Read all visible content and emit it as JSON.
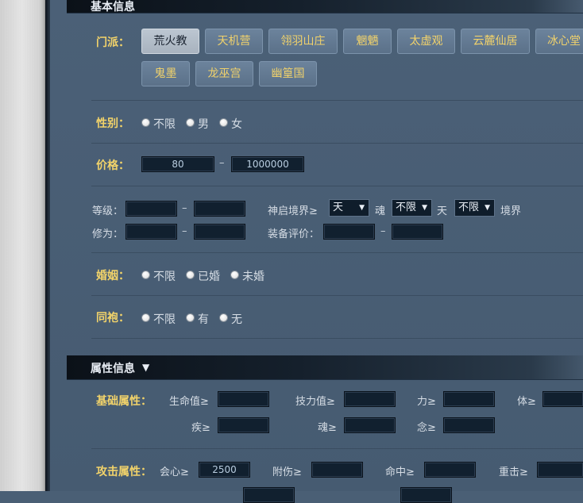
{
  "section_basic": {
    "title": "基本信息"
  },
  "sect": {
    "label": "门派：",
    "items": [
      "荒火教",
      "天机营",
      "翎羽山庄",
      "魍魉",
      "太虚观",
      "云麓仙居",
      "冰心堂",
      "鬼墨",
      "龙巫宫",
      "幽篁国"
    ]
  },
  "gender": {
    "label": "性别：",
    "options": [
      "不限",
      "男",
      "女"
    ]
  },
  "price": {
    "label": "价格：",
    "min": "80",
    "dash": "–",
    "max": "1000000"
  },
  "level": {
    "label": "等级：",
    "dash": "–"
  },
  "realm": {
    "label": "神启境界≥",
    "sel1": "天",
    "mid1": "魂",
    "sel2": "不限",
    "mid2": "天",
    "sel3": "不限",
    "suffix": "境界"
  },
  "cultivation": {
    "label": "修为：",
    "dash": "–"
  },
  "equip": {
    "label": "装备评价：",
    "dash": "–"
  },
  "marriage": {
    "label": "婚姻：",
    "options": [
      "不限",
      "已婚",
      "未婚"
    ]
  },
  "brother": {
    "label": "同袍：",
    "options": [
      "不限",
      "有",
      "无"
    ]
  },
  "section_attr": {
    "title": "属性信息",
    "caret": "▼"
  },
  "base_attr": {
    "label": "基础属性：",
    "hp": "生命值≥",
    "skill": "技力值≥",
    "str": "力≥",
    "con": "体≥",
    "agi": "疾≥",
    "soul": "魂≥",
    "mind": "念≥"
  },
  "atk_attr": {
    "label": "攻击属性：",
    "crit": "会心≥",
    "crit_val": "2500",
    "extra": "附伤≥",
    "hit": "命中≥",
    "heavy": "重击≥"
  }
}
